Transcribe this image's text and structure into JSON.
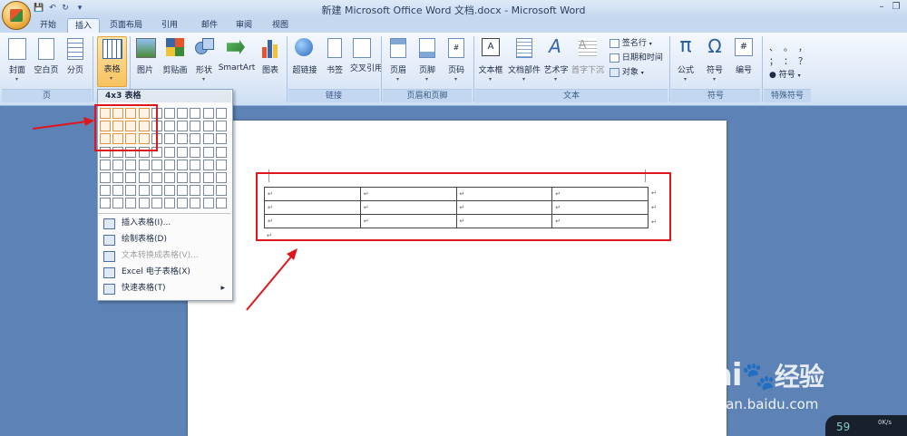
{
  "window": {
    "title": "新建 Microsoft Office Word 文档.docx - Microsoft Word"
  },
  "tabs": [
    "开始",
    "插入",
    "页面布局",
    "引用",
    "邮件",
    "审阅",
    "视图"
  ],
  "active_tab": "插入",
  "ribbon": {
    "groups": {
      "page": {
        "label": "页",
        "buttons": [
          "封面",
          "空白页",
          "分页"
        ]
      },
      "table": {
        "buttons": [
          "表格"
        ]
      },
      "illustrations": {
        "buttons": [
          "图片",
          "剪贴画",
          "形状",
          "SmartArt",
          "图表"
        ]
      },
      "links": {
        "label": "链接",
        "buttons": [
          "超链接",
          "书签",
          "交叉引用"
        ]
      },
      "header_footer": {
        "label": "页眉和页脚",
        "buttons": [
          "页眉",
          "页脚",
          "页码"
        ]
      },
      "text": {
        "label": "文本",
        "buttons": [
          "文本框",
          "文档部件",
          "艺术字",
          "首字下沉"
        ],
        "small": [
          "签名行",
          "日期和时间",
          "对象"
        ]
      },
      "symbols": {
        "label": "符号",
        "buttons": [
          "公式",
          "符号",
          "编号"
        ]
      },
      "special": {
        "label": "特殊符号",
        "symbols": [
          "、",
          "。",
          "，",
          "；",
          "：",
          "？"
        ],
        "button": "符号"
      }
    }
  },
  "table_dropdown": {
    "header": "4x3 表格",
    "grid": {
      "columns": 10,
      "rows": 8,
      "selected_cols": 4,
      "selected_rows": 3
    },
    "menu": [
      {
        "label": "插入表格(I)...",
        "disabled": false,
        "arrow": ""
      },
      {
        "label": "绘制表格(D)",
        "disabled": false,
        "arrow": ""
      },
      {
        "label": "文本转换成表格(V)...",
        "disabled": true,
        "arrow": ""
      },
      {
        "label": "Excel 电子表格(X)",
        "disabled": false,
        "arrow": ""
      },
      {
        "label": "快速表格(T)",
        "disabled": false,
        "arrow": "▸"
      }
    ]
  },
  "document": {
    "table": {
      "rows": 3,
      "cols": 4,
      "cell_mark": "↵"
    }
  },
  "watermark": {
    "logo": "Bai☺经验",
    "url": "jingyan.baidu.com"
  },
  "status": {
    "speed": "0K/s",
    "number": "59"
  },
  "colors": {
    "annotation": "#e0161d",
    "selection": "#e8913a",
    "ribbon": "#dfe9f7"
  }
}
